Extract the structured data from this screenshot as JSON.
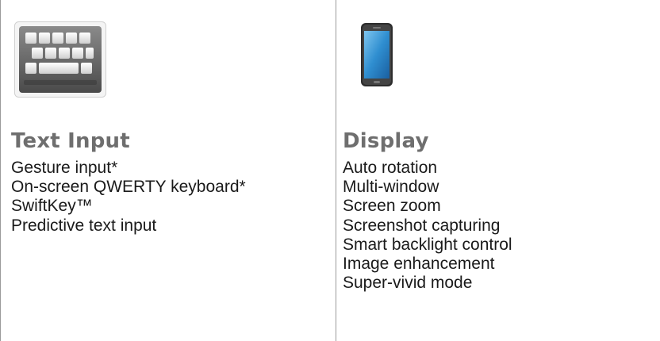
{
  "sections": [
    {
      "icon": "keyboard-icon",
      "title": "Text Input",
      "items": [
        "Gesture input*",
        "On-screen QWERTY keyboard*",
        "SwiftKey™",
        "Predictive text input"
      ]
    },
    {
      "icon": "smartphone-icon",
      "title": "Display",
      "items": [
        "Auto rotation",
        "Multi-window",
        "Screen zoom",
        "Screenshot capturing",
        "Smart backlight control",
        "Image enhancement",
        "Super-vivid mode"
      ]
    }
  ]
}
